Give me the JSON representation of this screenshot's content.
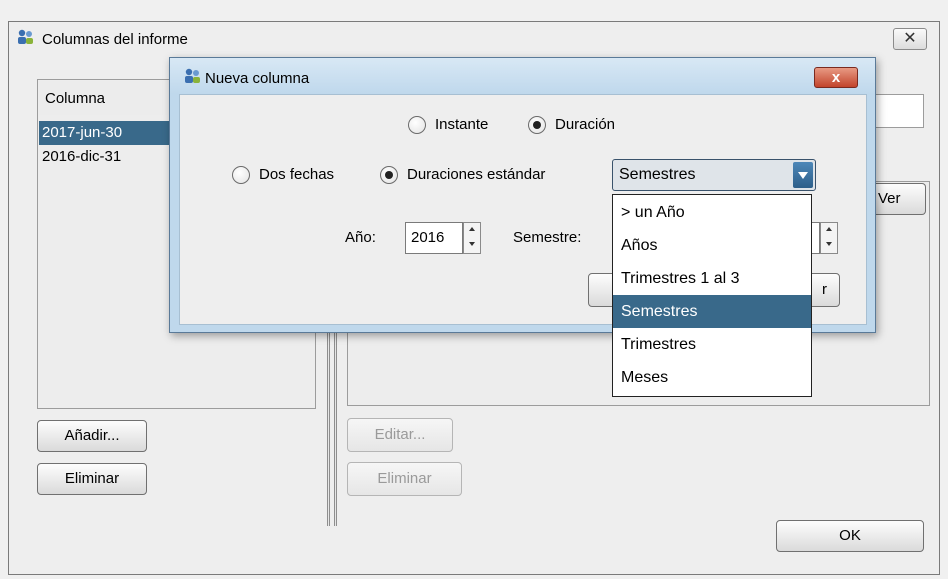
{
  "outer_window": {
    "title": "Columnas del informe",
    "close_label": "✕",
    "left_list": {
      "header": "Columna",
      "rows": [
        "2017-jun-30",
        "2016-dic-31"
      ],
      "selected_index": 0
    },
    "add_button": "Añadir...",
    "remove_button": "Eliminar",
    "right_peek_button": "Ver",
    "edit_button": "Editar...",
    "right_remove_button": "Eliminar",
    "ok_button": "OK"
  },
  "dialog": {
    "title": "Nueva columna",
    "close_label": "x",
    "mode_options": [
      {
        "label": "Instante",
        "selected": false
      },
      {
        "label": "Duración",
        "selected": true
      }
    ],
    "range_options": [
      {
        "label": "Dos fechas",
        "selected": false
      },
      {
        "label": "Duraciones estándar",
        "selected": true
      }
    ],
    "duration_select": {
      "value": "Semestres",
      "options": [
        "> un Año",
        "Años",
        "Trimestres 1 al 3",
        "Semestres",
        "Trimestres",
        "Meses"
      ],
      "highlighted_index": 3
    },
    "year_label": "Año:",
    "year_value": "2016",
    "semester_label": "Semestre:",
    "accept_button_tail": "r"
  },
  "colors": {
    "selection": "#39698a",
    "dialog_frame": "#bfd8ec",
    "close_red": "#c2442c"
  }
}
